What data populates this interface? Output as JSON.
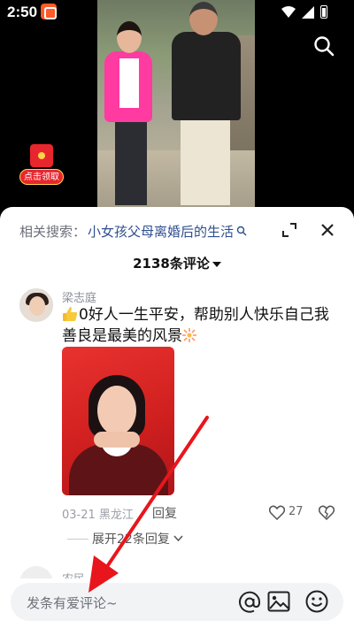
{
  "status_bar": {
    "time": "2:50"
  },
  "video": {
    "redpacket_label": "点击领取"
  },
  "sheet": {
    "related_label": "相关搜索：",
    "related_query": "小女孩父母离婚后的生活",
    "comment_count": "2138条评论"
  },
  "comments": [
    {
      "user": "梁志庭",
      "text": "0好人一生平安，帮助别人快乐自己我善良是最美的风景",
      "date_location": "03-21 黑龙江",
      "reply_label": "回复",
      "likes": "27",
      "expand_replies": "展开22条回复"
    },
    {
      "user": "农民"
    }
  ],
  "input": {
    "placeholder": "发条有爱评论~"
  },
  "colors": {
    "accent_link": "#2f4f8e",
    "arrow": "#e8161c",
    "redpacket": "#e8262d"
  },
  "icons": [
    "search-icon",
    "redpacket-icon",
    "expand-icon",
    "close-icon",
    "caret-down-icon",
    "thumbs-up-emoji-icon",
    "sparkle-emoji-icon",
    "like-icon",
    "dislike-icon",
    "chevron-down-icon",
    "at-icon",
    "image-icon",
    "emoji-icon"
  ]
}
